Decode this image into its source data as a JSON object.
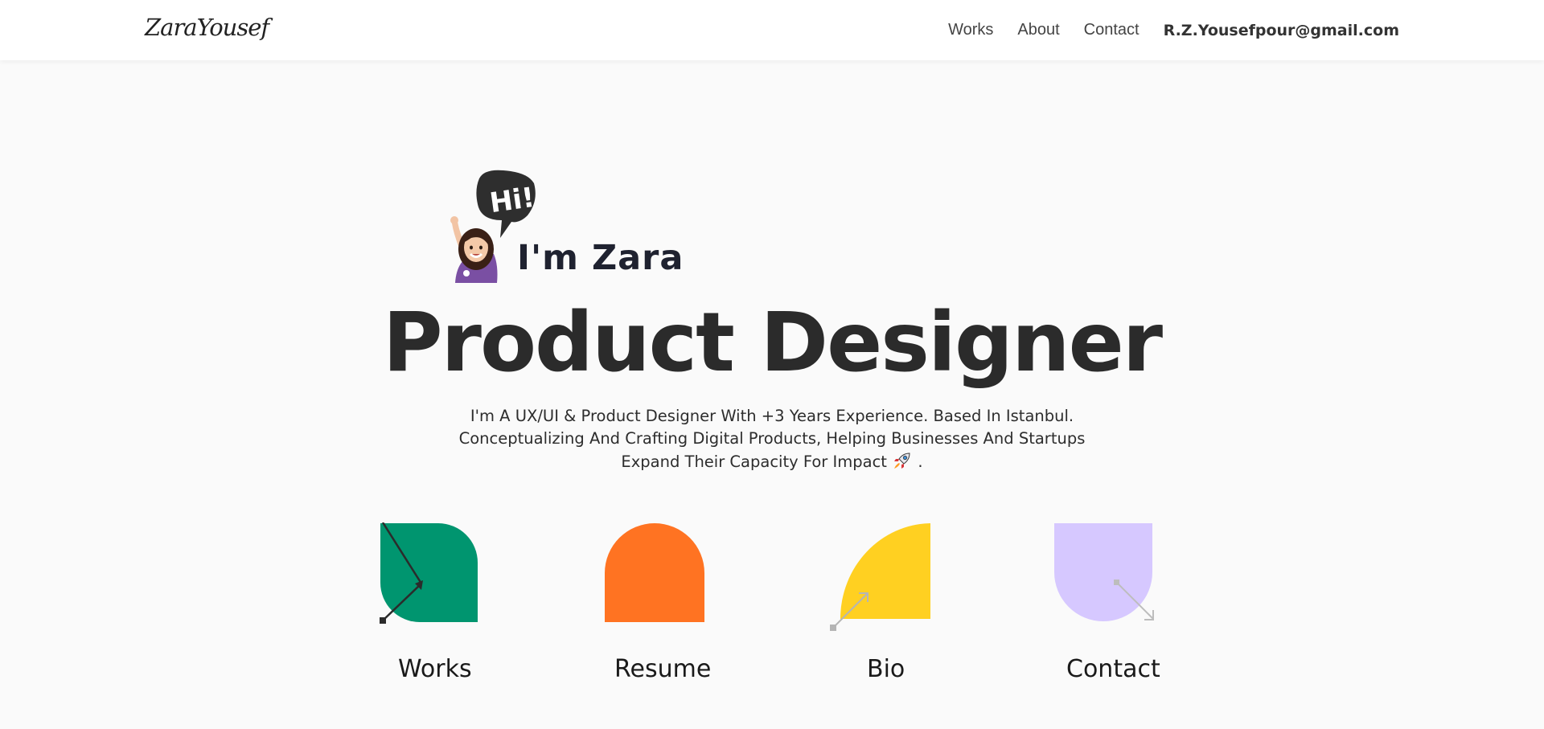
{
  "header": {
    "logo": "ZaraYousef",
    "nav": [
      {
        "label": "Works"
      },
      {
        "label": "About"
      },
      {
        "label": "Contact"
      }
    ],
    "email": "R.Z.Yousefpour@gmail.com"
  },
  "hero": {
    "speech_bubble": "Hi!",
    "greeting": "I'm Zara",
    "title": "Product Designer",
    "description": [
      "I'm A UX/UI & Product Designer With +3 Years Experience. Based In Istanbul.",
      "Conceptualizing And Crafting Digital Products, Helping Businesses And Startups",
      "Expand Their Capacity For Impact"
    ],
    "description_end": ".",
    "rocket_icon": "rocket-icon"
  },
  "cards": [
    {
      "label": "Works",
      "color": "#00956f",
      "icon": "arrow-up-right-icon"
    },
    {
      "label": "Resume",
      "color": "#ff7322",
      "icon": "none"
    },
    {
      "label": "Bio",
      "color": "#ffd021",
      "icon": "arrow-up-right-icon"
    },
    {
      "label": "Contact",
      "color": "#d6c8ff",
      "icon": "arrow-down-right-icon"
    }
  ]
}
